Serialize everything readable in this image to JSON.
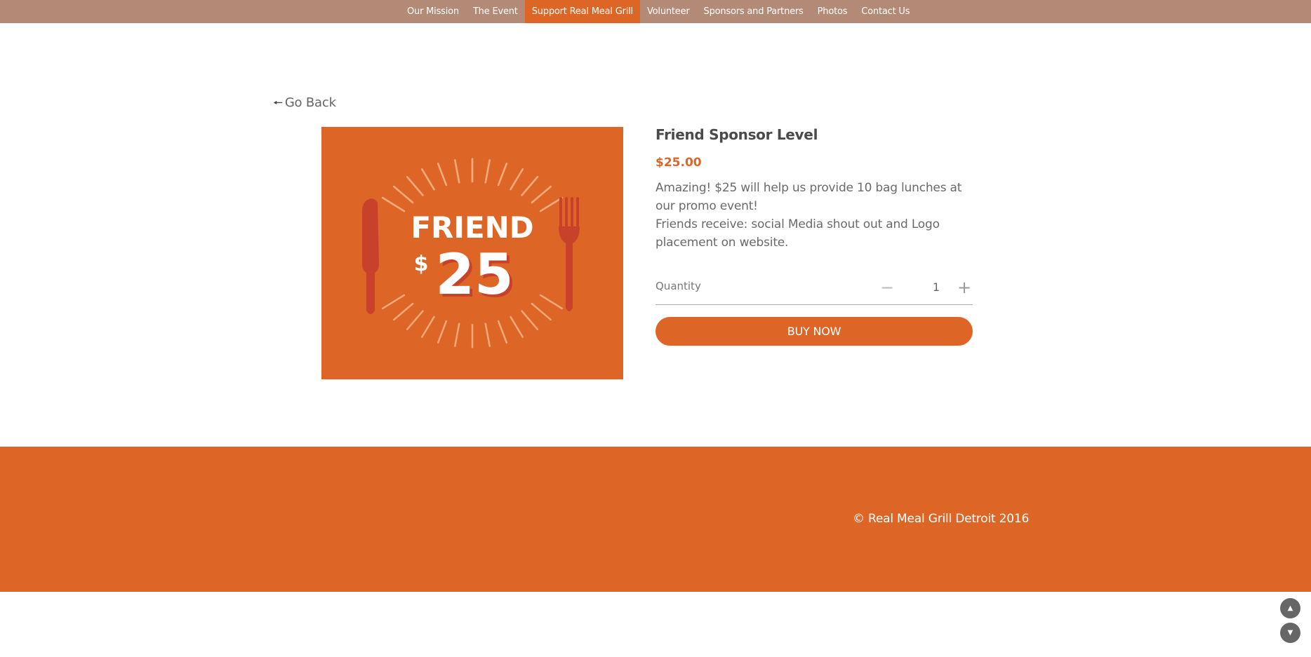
{
  "nav": {
    "items": [
      {
        "label": "Our Mission"
      },
      {
        "label": "The Event"
      },
      {
        "label": "Support Real Meal Grill"
      },
      {
        "label": "Volunteer"
      },
      {
        "label": "Sponsors and Partners"
      },
      {
        "label": "Photos"
      },
      {
        "label": "Contact Us"
      }
    ],
    "active": "Support Real Meal Grill"
  },
  "go_back": {
    "arrow": "🠔",
    "label": "Go Back"
  },
  "product": {
    "image": {
      "word": "FRIEND",
      "currency": "$",
      "amount": "25"
    },
    "title": "Friend Sponsor Level",
    "price": "$25.00",
    "description_line1": "Amazing! $25 will help us provide 10 bag lunches at our promo event!",
    "description_line2": "Friends receive: social Media shout out and Logo placement on website.",
    "quantity_label": "Quantity",
    "quantity": "1",
    "minus": "−",
    "plus": "+",
    "buy_label": "BUY NOW"
  },
  "footer": {
    "copyright": "© Real Meal Grill Detroit 2016"
  },
  "scroll": {
    "up": "▲",
    "down": "▼"
  },
  "colors": {
    "brand_orange": "#dd6627",
    "nav_brown": "#b38a76",
    "utensil_red": "#c8422b"
  }
}
